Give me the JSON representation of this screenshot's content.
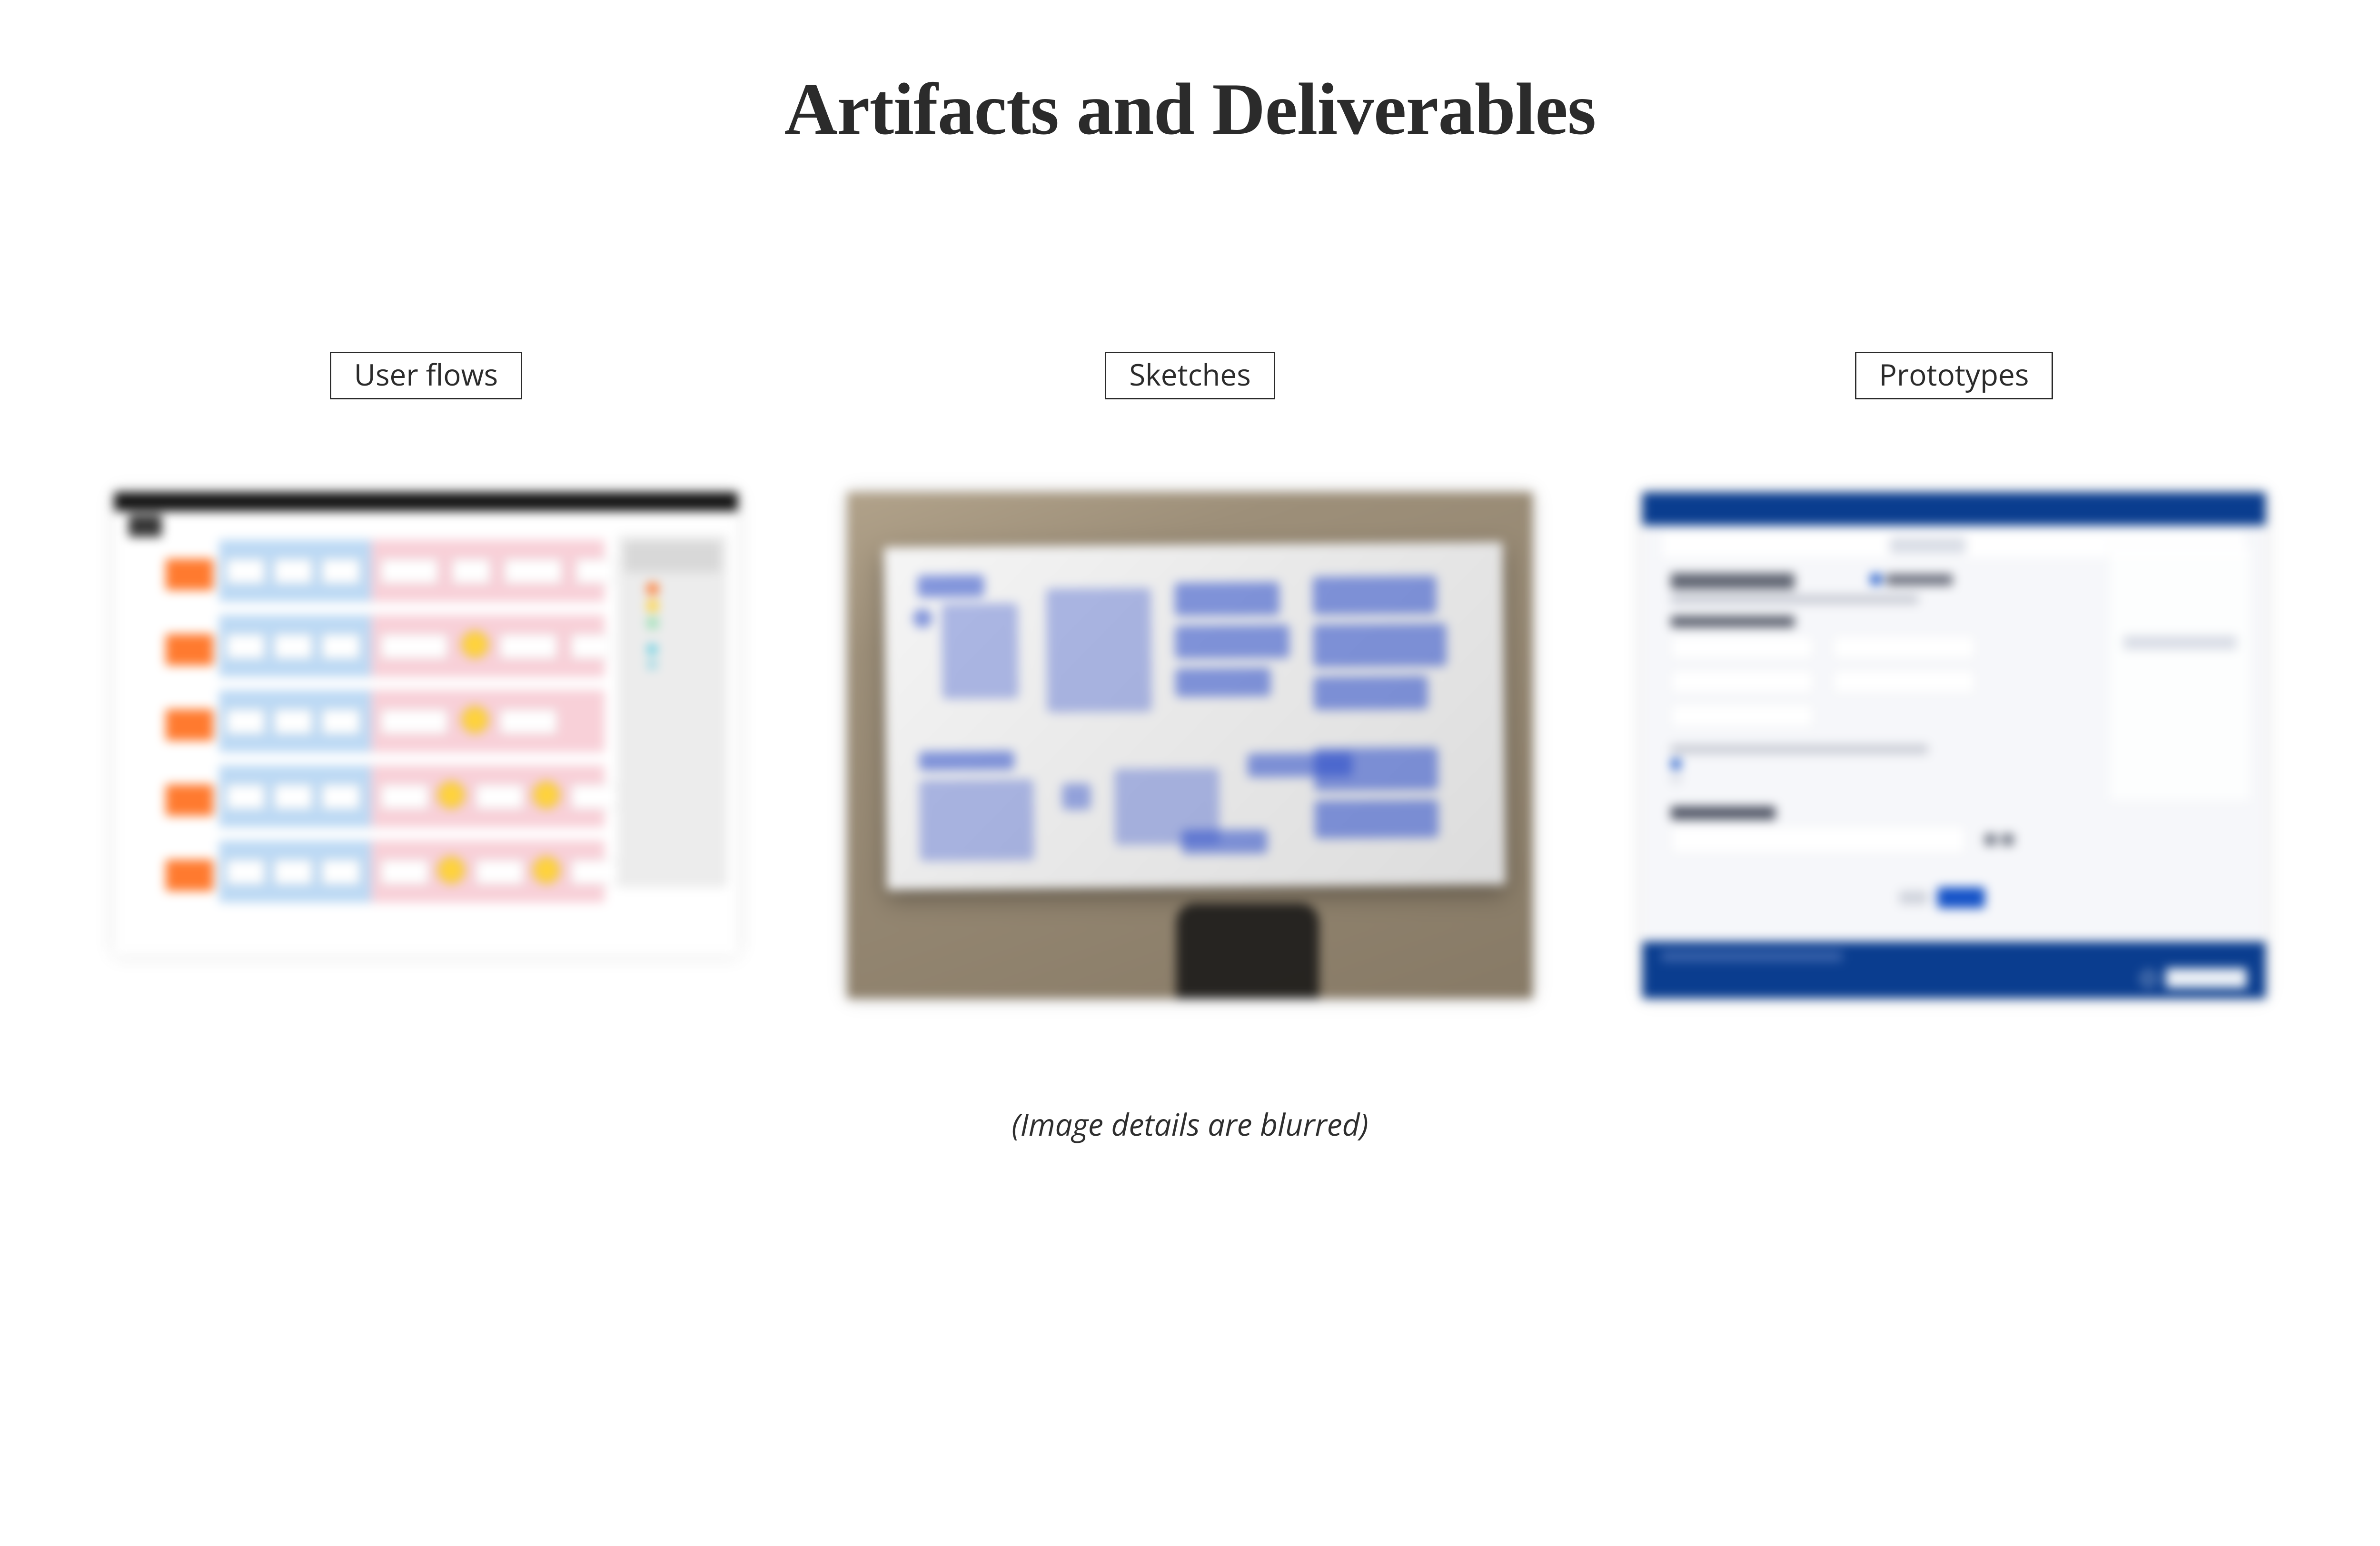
{
  "title": "Artifacts and Deliverables",
  "cards": {
    "userflows_label": "User flows",
    "sketches_label": "Sketches",
    "prototypes_label": "Prototypes"
  },
  "caption": "(Image details are blurred)"
}
